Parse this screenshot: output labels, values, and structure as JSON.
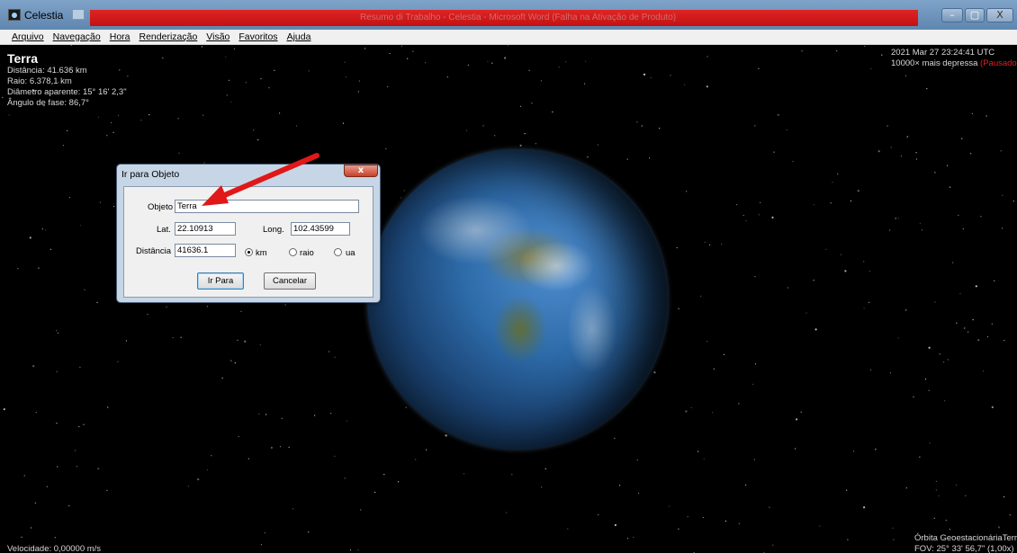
{
  "window": {
    "app_title": "Celestia",
    "red_strip_text": "Resumo di Trabalho - Celestia - Microsoft Word (Falha na Ativação de Produto)",
    "minimize_glyph": "–",
    "maximize_glyph": "▢",
    "close_glyph": "X"
  },
  "menu": {
    "items": [
      "Arquivo",
      "Navegação",
      "Hora",
      "Renderização",
      "Visão",
      "Favoritos",
      "Ajuda"
    ]
  },
  "hud": {
    "object_name": "Terra",
    "distance": "Distância: 41.636 km",
    "radius": "Raio: 6.378,1 km",
    "apparent_diameter": "Diâmetro aparente: 15° 16' 2,3\"",
    "phase_angle": "Ângulo de fase: 86,7°",
    "datetime": "2021 Mar 27 23:24:41 UTC",
    "time_rate": "10000× mais depressa",
    "paused": "(Pausado)",
    "speed": "Velocidade: 0,00000 m/s",
    "orbit_mode": "Órbita GeoestacionáriaTerra",
    "fov": "FOV: 25° 33' 56,7\" (1,00x)"
  },
  "dialog": {
    "title": "Ir para Objeto",
    "close_glyph": "x",
    "object_label": "Objeto",
    "object_value": "Terra",
    "lat_label": "Lat.",
    "lat_value": "22.10913",
    "long_label": "Long.",
    "long_value": "102.43599",
    "distance_label": "Distância",
    "distance_value": "41636.1",
    "units": [
      "km",
      "raio",
      "ua"
    ],
    "selected_unit": "km",
    "go_button": "Ir Para",
    "cancel_button": "Cancelar"
  },
  "colors": {
    "annotation_arrow": "#e01818",
    "paused_text": "#e02020"
  },
  "icons": [
    "celestia-app-icon",
    "quick-access-icon",
    "minimize-icon",
    "maximize-icon",
    "close-icon",
    "dialog-close-icon",
    "annotation-arrow"
  ]
}
